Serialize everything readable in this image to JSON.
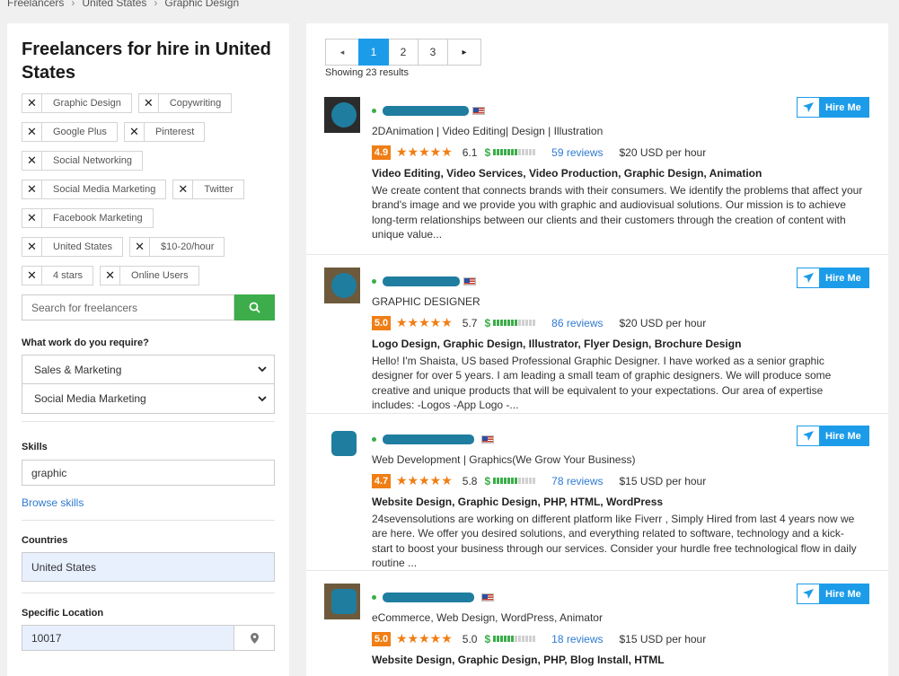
{
  "breadcrumb": [
    "Freelancers",
    "United States",
    "Graphic Design"
  ],
  "sidebar": {
    "title": "Freelancers for hire in United States",
    "filters": [
      "Graphic Design",
      "Copywriting",
      "Google Plus",
      "Pinterest",
      "Social Networking",
      "Social Media Marketing",
      "Twitter",
      "Facebook Marketing",
      "United States",
      "$10-20/hour",
      "4 stars",
      "Online Users"
    ],
    "search_placeholder": "Search for freelancers",
    "work_label": "What work do you require?",
    "category": "Sales & Marketing",
    "subcategory": "Social Media Marketing",
    "skills_label": "Skills",
    "skills_value": "graphic",
    "browse_skills": "Browse skills",
    "countries_label": "Countries",
    "countries_value": "United States",
    "location_label": "Specific Location",
    "location_value": "10017"
  },
  "pagination": {
    "prev": "◂",
    "pages": [
      "1",
      "2",
      "3"
    ],
    "next": "▸",
    "current": "1",
    "showing": "Showing 23 results"
  },
  "hire_label": "Hire Me",
  "colors": {
    "accent": "#1c9ce8",
    "green": "#3cad4a",
    "rating": "#f07e14",
    "link": "#2e7ad1"
  },
  "freelancers": [
    {
      "tagline": "2DAnimation | Video Editing| Design | Illustration",
      "rating": "4.9",
      "stars": "★★★★★",
      "score": "6.1",
      "score_fill": 0.61,
      "reviews": "59 reviews",
      "rate": "$20 USD per hour",
      "skills": "Video Editing, Video Services, Video Production, Graphic Design, Animation",
      "description": "We create content that connects brands with their consumers. We identify the problems that affect your brand's image and we provide you with graphic and audiovisual solutions. Our mission is to achieve long-term relationships between our clients and their customers through the creation of content with unique value..."
    },
    {
      "tagline": "GRAPHIC DESIGNER",
      "rating": "5.0",
      "stars": "★★★★★",
      "score": "5.7",
      "score_fill": 0.57,
      "reviews": "86 reviews",
      "rate": "$20 USD per hour",
      "skills": "Logo Design, Graphic Design, Illustrator, Flyer Design, Brochure Design",
      "description": "Hello! I'm Shaista, US based Professional Graphic Designer. I have worked as a senior graphic designer for over 5 years. I am leading a small team of graphic designers. We will produce some creative and unique products that will be equivalent to your expectations. Our area of expertise includes: -Logos -App Logo -..."
    },
    {
      "tagline": "Web Development | Graphics(We Grow Your Business)",
      "rating": "4.7",
      "stars": "★★★★★",
      "score": "5.8",
      "score_fill": 0.58,
      "reviews": "78 reviews",
      "rate": "$15 USD per hour",
      "skills": "Website Design, Graphic Design, PHP, HTML, WordPress",
      "description": "24sevensolutions are working on different platform like Fiverr , Simply Hired from last 4 years now we are here. We offer you desired solutions, and everything related to software, technology and a kick-start to boost your business through our services. Consider your hurdle free technological flow in daily routine ..."
    },
    {
      "tagline": "eCommerce, Web Design, WordPress, Animator",
      "rating": "5.0",
      "stars": "★★★★★",
      "score": "5.0",
      "score_fill": 0.5,
      "reviews": "18 reviews",
      "rate": "$15 USD per hour",
      "skills": "Website Design, Graphic Design, PHP, Blog Install, HTML",
      "description": ""
    }
  ]
}
